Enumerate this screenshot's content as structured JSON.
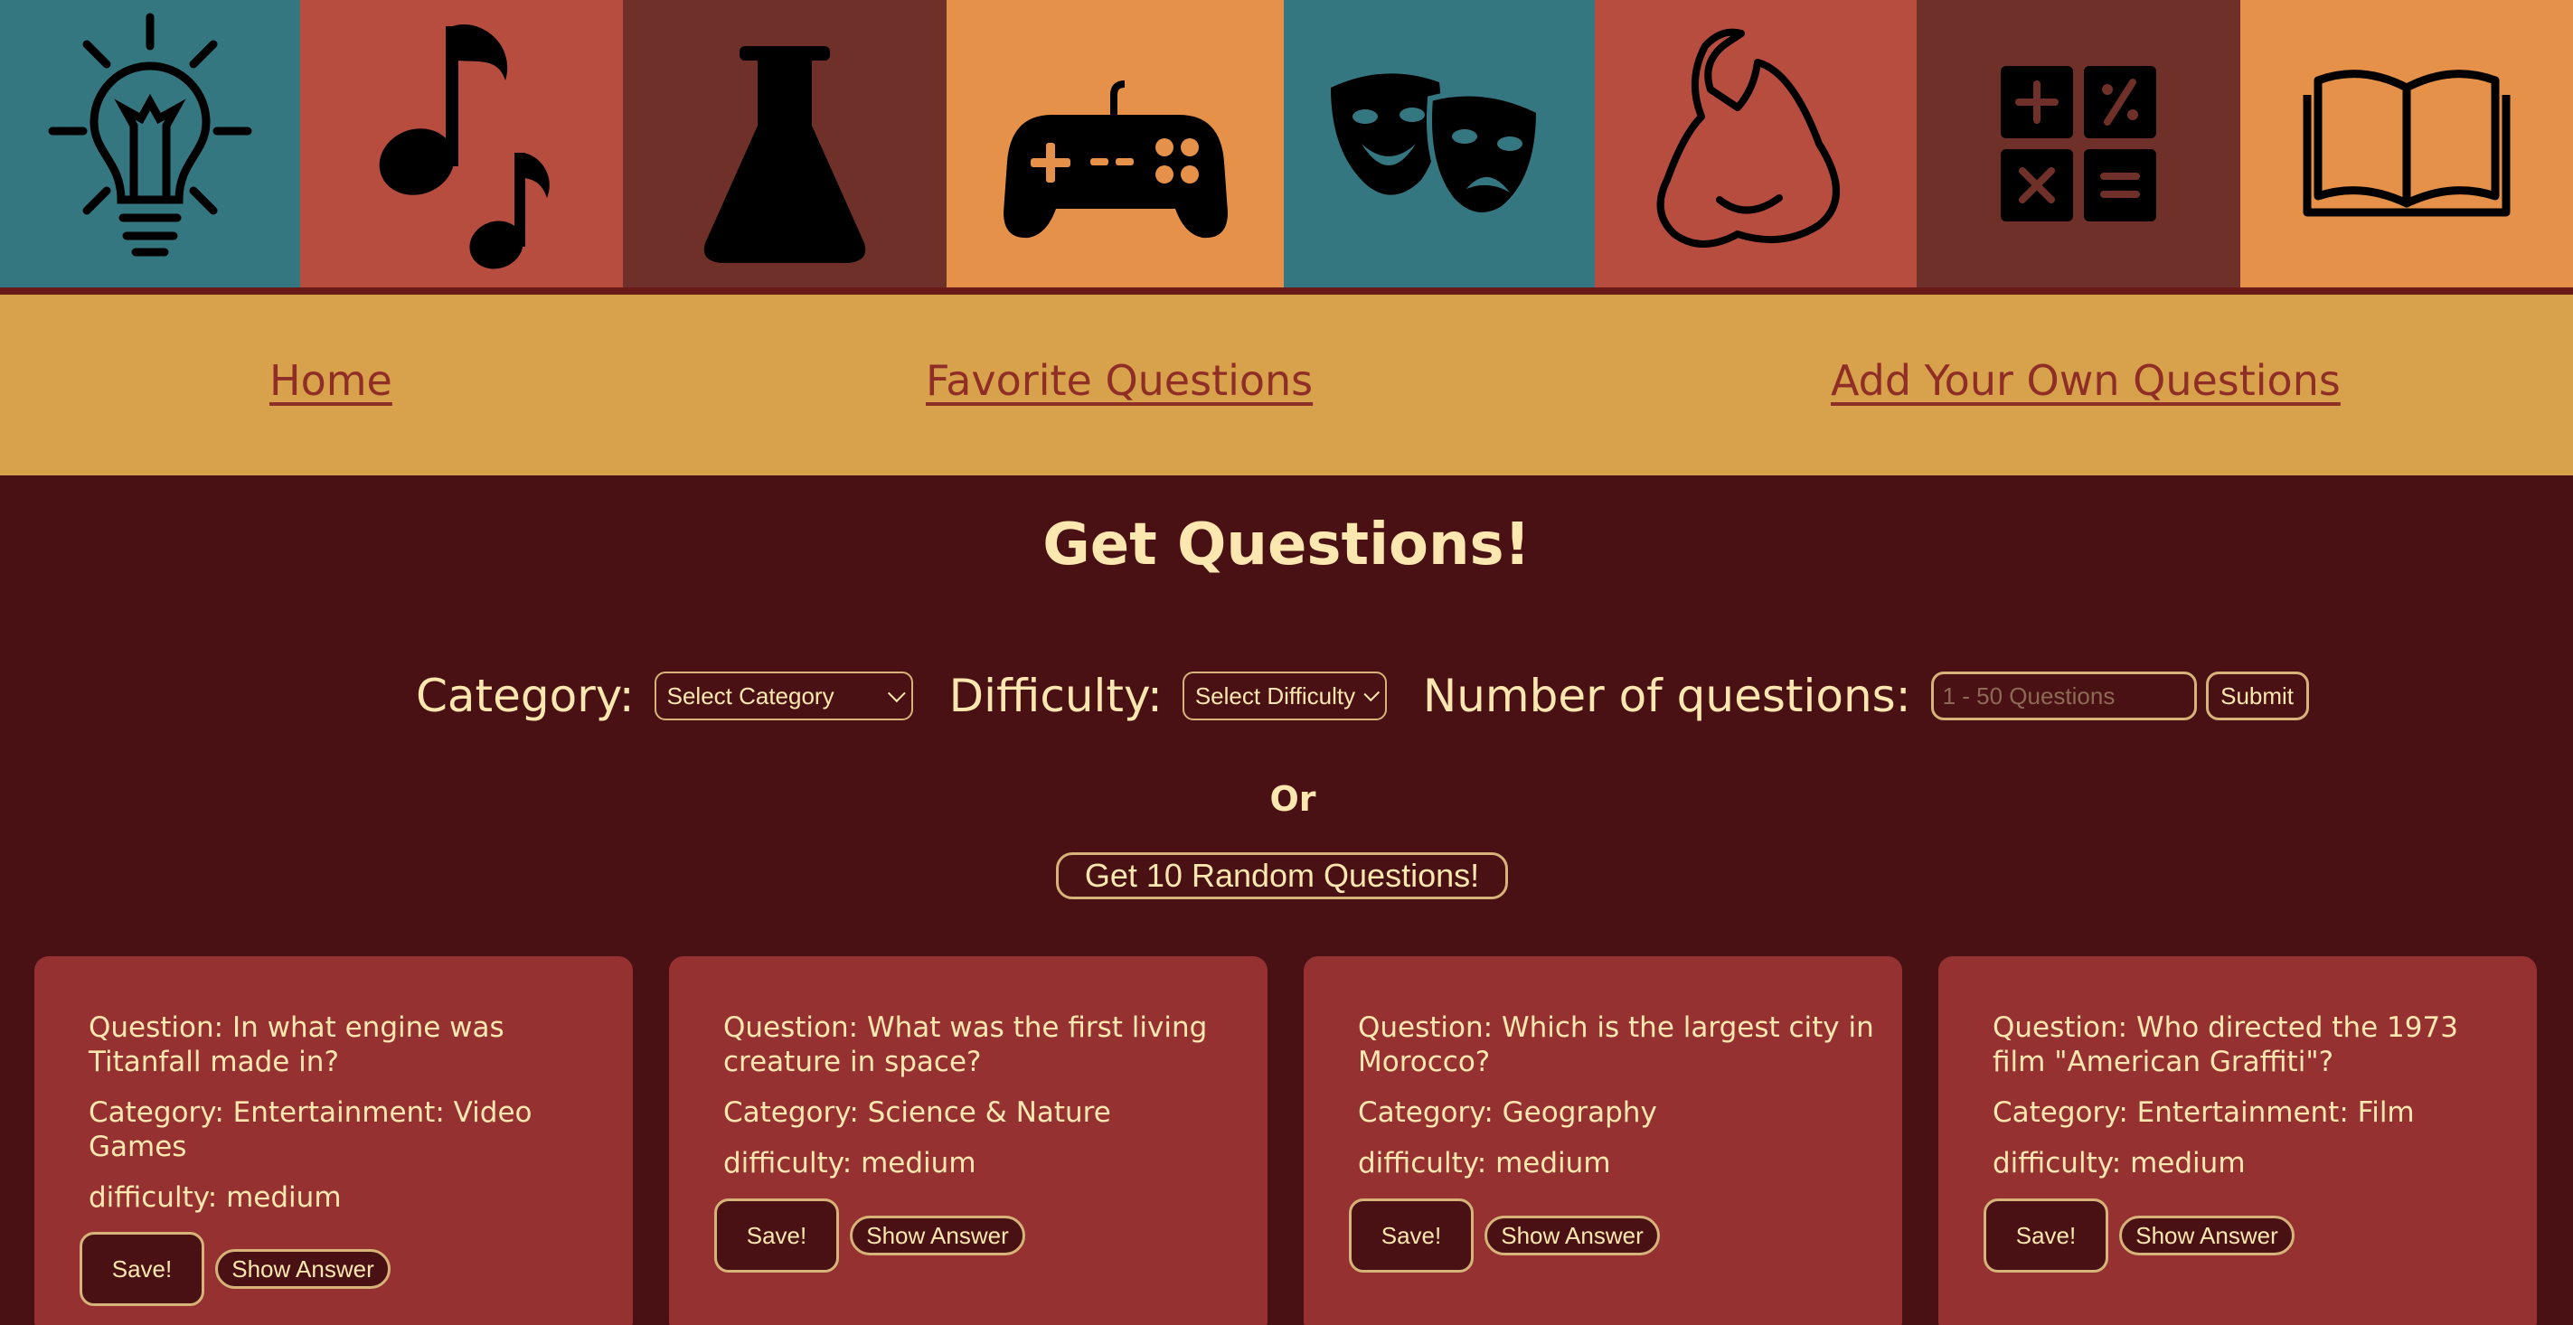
{
  "theme": {
    "background": "#4a1114",
    "accent": "#d8a24c",
    "text": "#fde7b0",
    "card": "#953231",
    "link": "#8f2d27"
  },
  "banner": {
    "tiles": [
      {
        "icon": "lightbulb-icon",
        "color": "#357781"
      },
      {
        "icon": "music-note-icon",
        "color": "#b64d3f"
      },
      {
        "icon": "flask-icon",
        "color": "#6e3029"
      },
      {
        "icon": "gamepad-icon",
        "color": "#e69149"
      },
      {
        "icon": "theater-masks-icon",
        "color": "#357781"
      },
      {
        "icon": "flexed-arm-icon",
        "color": "#b64d3f"
      },
      {
        "icon": "calculator-icon",
        "color": "#6e3029"
      },
      {
        "icon": "open-book-icon",
        "color": "#e69149"
      }
    ]
  },
  "nav": {
    "home": "Home",
    "favorites": "Favorite Questions",
    "add": "Add Your Own Questions"
  },
  "main": {
    "title": "Get Questions!",
    "category_label": "Category:",
    "category_value": "Select Category",
    "difficulty_label": "Difficulty:",
    "difficulty_value": "Select Difficulty",
    "number_label": "Number of questions:",
    "number_placeholder": "1 - 50 Questions",
    "submit": "Submit",
    "or": "Or",
    "random": "Get 10 Random Questions!"
  },
  "cards": [
    {
      "question": "Question: In what engine was Titanfall made in?",
      "category": "Category: Entertainment: Video Games",
      "difficulty": "difficulty: medium",
      "save": "Save!",
      "show": "Show Answer"
    },
    {
      "question": "Question: What was the first living creature in space?",
      "category": "Category: Science & Nature",
      "difficulty": "difficulty: medium",
      "save": "Save!",
      "show": "Show Answer"
    },
    {
      "question": "Question: Which is the largest city in Morocco?",
      "category": "Category: Geography",
      "difficulty": "difficulty: medium",
      "save": "Save!",
      "show": "Show Answer"
    },
    {
      "question": "Question: Who directed the 1973 film \"American Graffiti\"?",
      "category": "Category: Entertainment: Film",
      "difficulty": "difficulty: medium",
      "save": "Save!",
      "show": "Show Answer"
    }
  ]
}
